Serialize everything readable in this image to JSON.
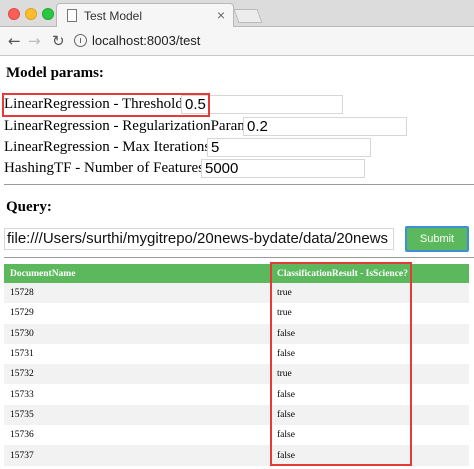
{
  "browser": {
    "tab_title": "Test Model",
    "tab_close": "×",
    "url_host": "localhost:8003/test",
    "back_glyph": "←",
    "forward_glyph": "→",
    "reload_glyph": "↻"
  },
  "model_params": {
    "heading": "Model params:",
    "fields": [
      {
        "label": "LinearRegression - Threshold",
        "value": "0.5"
      },
      {
        "label": "LinearRegression - RegularizationParam",
        "value": "0.2"
      },
      {
        "label": "LinearRegression - Max Iterations",
        "value": "5"
      },
      {
        "label": "HashingTF - Number of Features",
        "value": "5000"
      }
    ]
  },
  "query": {
    "heading": "Query:",
    "value": "file:///Users/surthi/mygitrepo/20news-bydate/data/20news",
    "submit_label": "Submit"
  },
  "results": {
    "columns": [
      "DocumentName",
      "ClassificationResult - IsScience?"
    ],
    "rows": [
      [
        "15728",
        "true"
      ],
      [
        "15729",
        "true"
      ],
      [
        "15730",
        "false"
      ],
      [
        "15731",
        "false"
      ],
      [
        "15732",
        "true"
      ],
      [
        "15733",
        "false"
      ],
      [
        "15735",
        "false"
      ],
      [
        "15736",
        "false"
      ],
      [
        "15737",
        "false"
      ]
    ]
  },
  "colors": {
    "accent_green": "#5cb85c",
    "highlight_red": "#e53a35",
    "button_border_blue": "#3f8fd6"
  }
}
